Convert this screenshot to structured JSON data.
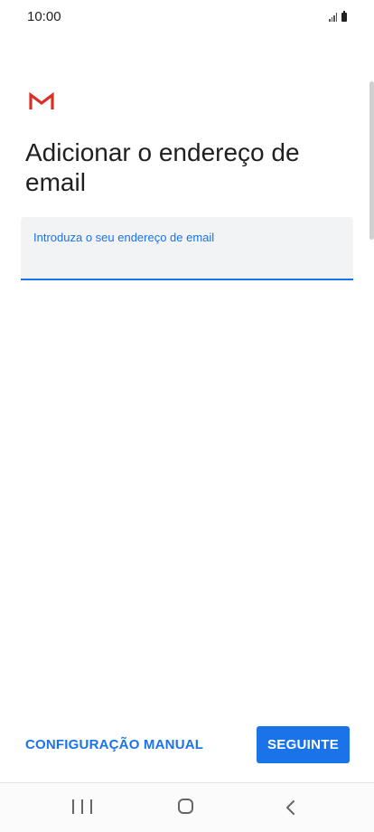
{
  "status_bar": {
    "time": "10:00",
    "signal_icon": "signal-icon",
    "battery_icon": "battery-icon"
  },
  "app": {
    "logo_icon": "gmail-logo-icon",
    "brand_color": "#d93025"
  },
  "title": "Adicionar o endereço de email",
  "email_field": {
    "label": "Introduza o seu endereço de email",
    "value": "",
    "placeholder": ""
  },
  "buttons": {
    "manual_label": "CONFIGURAÇÃO MANUAL",
    "next_label": "SEGUINTE"
  },
  "nav_bar": {
    "recents_icon": "recents-icon",
    "home_icon": "home-icon",
    "back_icon": "back-icon"
  },
  "colors": {
    "accent": "#1a73e8",
    "field_background": "#f1f3f4",
    "text": "#1f1f1f"
  }
}
